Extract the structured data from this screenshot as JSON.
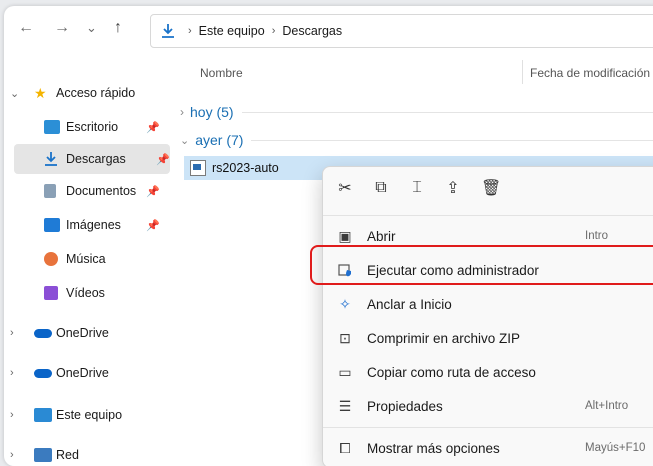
{
  "toolbar": {
    "back": "←",
    "forward": "→",
    "history": "⌄",
    "up": "↑",
    "address": [
      "Este equipo",
      "Descargas"
    ]
  },
  "sidebar": {
    "items": [
      {
        "label": "Acceso rápido",
        "icon": "star-icon",
        "pinned": false
      },
      {
        "label": "Escritorio",
        "icon": "desktop-icon",
        "pinned": true
      },
      {
        "label": "Descargas",
        "icon": "download-icon",
        "pinned": true,
        "selected": true
      },
      {
        "label": "Documentos",
        "icon": "documents-icon",
        "pinned": true
      },
      {
        "label": "Imágenes",
        "icon": "pictures-icon",
        "pinned": true
      },
      {
        "label": "Música",
        "icon": "music-icon",
        "pinned": false
      },
      {
        "label": "Vídeos",
        "icon": "videos-icon",
        "pinned": false
      },
      {
        "label": "OneDrive",
        "icon": "cloud-icon",
        "pinned": false
      },
      {
        "label": "OneDrive",
        "icon": "cloud-icon",
        "pinned": false
      },
      {
        "label": "Este equipo",
        "icon": "pc-icon",
        "pinned": false
      },
      {
        "label": "Red",
        "icon": "network-icon",
        "pinned": false
      }
    ]
  },
  "columns": {
    "name": "Nombre",
    "date": "Fecha de modificación"
  },
  "groups": [
    {
      "label": "hoy (5)",
      "expanded": false
    },
    {
      "label": "ayer (7)",
      "expanded": true
    }
  ],
  "file": {
    "name": "rs2023-auto"
  },
  "context_menu": {
    "icon_bar": [
      "cut-icon",
      "copy-icon",
      "rename-icon",
      "share-icon",
      "delete-icon"
    ],
    "items": [
      {
        "label": "Abrir",
        "shortcut": "Intro",
        "icon": "open-icon"
      },
      {
        "label": "Ejecutar como administrador",
        "shortcut": "",
        "icon": "shield-icon"
      },
      {
        "label": "Anclar a Inicio",
        "shortcut": "",
        "icon": "pin-icon"
      },
      {
        "label": "Comprimir en archivo ZIP",
        "shortcut": "",
        "icon": "zip-icon"
      },
      {
        "label": "Copiar como ruta de acceso",
        "shortcut": "",
        "icon": "path-icon"
      },
      {
        "label": "Propiedades",
        "shortcut": "Alt+Intro",
        "icon": "properties-icon"
      },
      {
        "label": "Mostrar más opciones",
        "shortcut": "Mayús+F10",
        "icon": "more-options-icon"
      }
    ]
  },
  "colors": {
    "accent": "#0067c0",
    "highlight_outline": "#e01b1b",
    "selected_row": "#cce4f7"
  }
}
